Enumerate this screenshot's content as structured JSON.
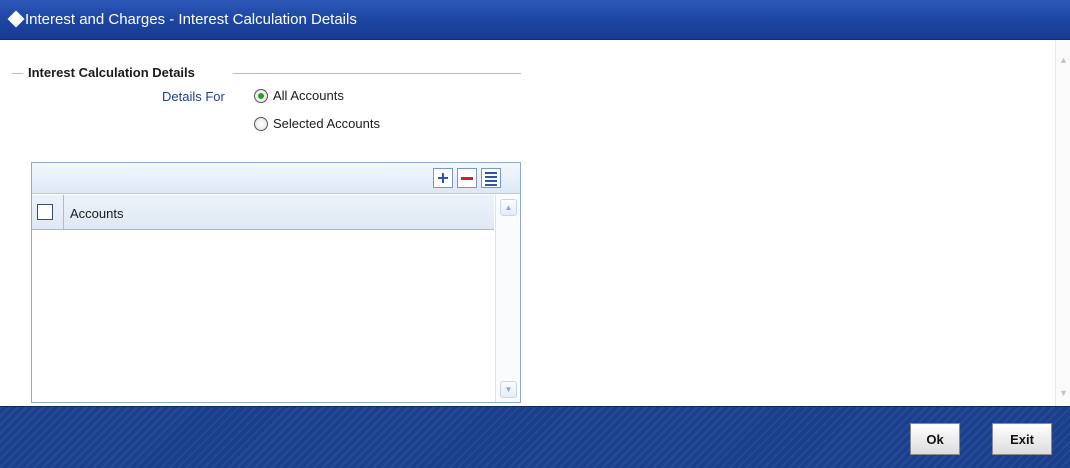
{
  "window": {
    "title": "Interest and Charges - Interest Calculation Details"
  },
  "section": {
    "title": "Interest Calculation Details"
  },
  "details_for": {
    "label": "Details For",
    "options": [
      {
        "label": "All Accounts",
        "selected": true
      },
      {
        "label": "Selected Accounts",
        "selected": false
      }
    ]
  },
  "grid": {
    "columns": [
      "Accounts"
    ],
    "rows": [],
    "toolbar_icons": [
      "add-row-icon",
      "delete-row-icon",
      "view-rows-icon"
    ]
  },
  "footer": {
    "ok_label": "Ok",
    "exit_label": "Exit"
  },
  "colors": {
    "titlebar": "#1c44a0",
    "footer": "#1a3f8c",
    "accent_label": "#1f3f8a",
    "radio_dot": "#2a9a2a",
    "delete_icon": "#d42020"
  }
}
